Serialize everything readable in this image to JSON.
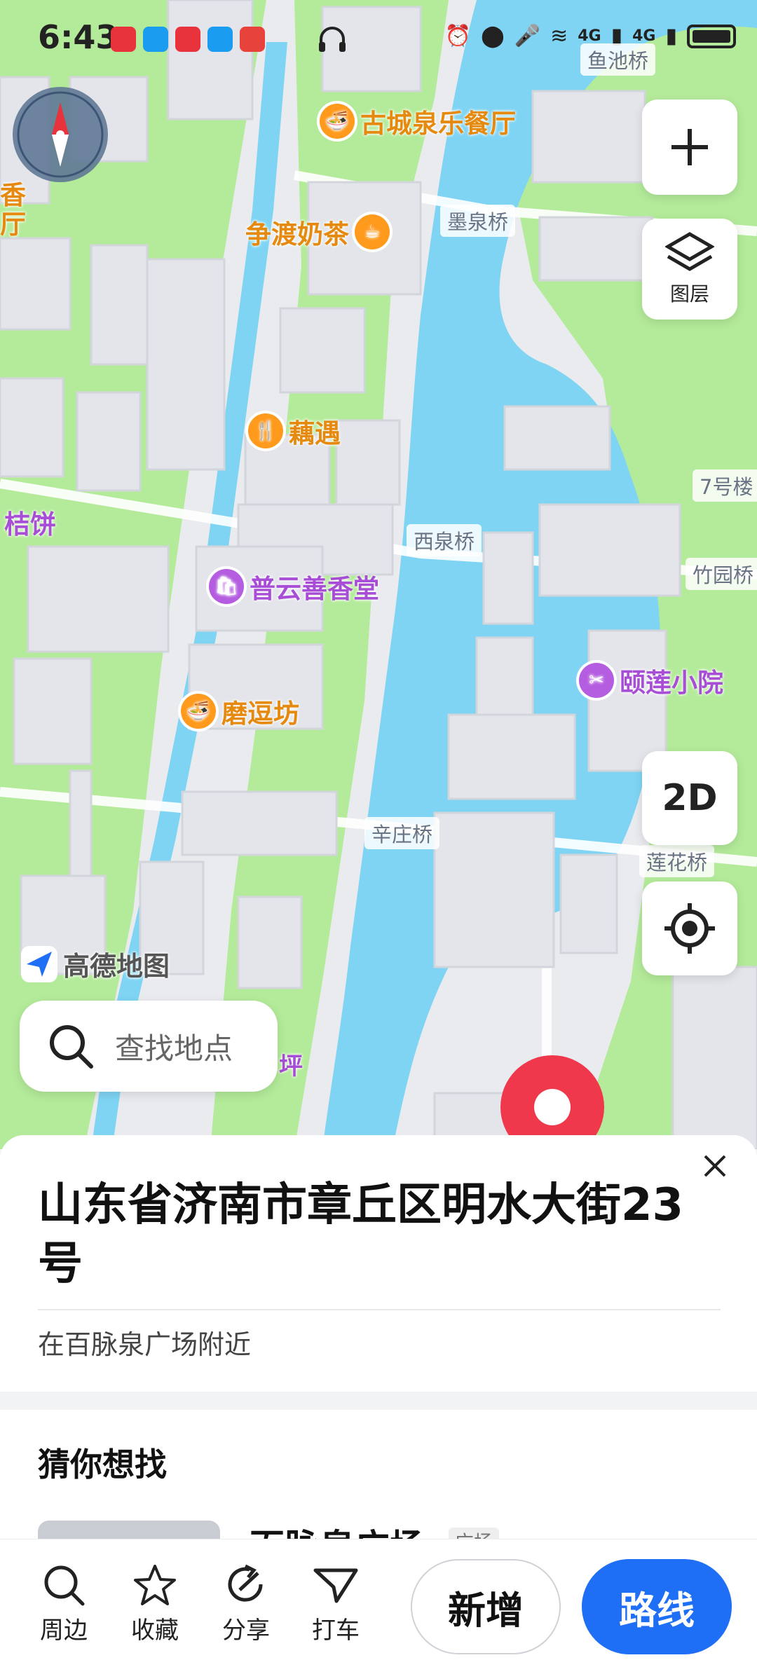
{
  "status_bar": {
    "time": "6:43",
    "network_left": "4G",
    "network_right": "4G"
  },
  "map": {
    "pois": [
      {
        "name": "古城泉乐餐厅",
        "icon": "noodle-icon",
        "color": "orange"
      },
      {
        "name": "争渡奶茶",
        "icon": "coffee-icon",
        "color": "orange"
      },
      {
        "name": "藕遇",
        "icon": "utensils-icon",
        "color": "orange"
      },
      {
        "name": "普云善香堂",
        "icon": "shopping-bag-icon",
        "color": "purple"
      },
      {
        "name": "磨逗坊",
        "icon": "noodle-icon",
        "color": "orange"
      },
      {
        "name": "颐莲小院",
        "icon": "scissors-icon",
        "color": "purple"
      },
      {
        "name": "桔饼",
        "icon": "",
        "color": "purple"
      },
      {
        "name": "香",
        "icon": "",
        "color": "orange"
      },
      {
        "name": "厅",
        "icon": "",
        "color": "orange"
      },
      {
        "name": "坪",
        "icon": "",
        "color": "purple"
      }
    ],
    "road_labels": [
      "鱼池桥",
      "墨泉桥",
      "西泉桥",
      "辛庄桥",
      "莲花桥",
      "7号楼",
      "竹园桥"
    ],
    "layers_label": "图层",
    "mode_label": "2D",
    "logo_text": "高德地图",
    "search_placeholder": "查找地点"
  },
  "sheet": {
    "title": "山东省济南市章丘区明水大街23号",
    "nearby": "在百脉泉广场附近",
    "guess_title": "猜你想找",
    "result_name": "百脉泉广场",
    "result_tag": "广场"
  },
  "bottom_bar": {
    "nearby": "周边",
    "favorite": "收藏",
    "share": "分享",
    "taxi": "打车",
    "add": "新增",
    "route": "路线"
  },
  "colors": {
    "water": "#7fd4f4",
    "park": "#b4eb9a",
    "building": "#e6e7eb",
    "accent": "#1e6ff5",
    "pin": "#f0384c"
  }
}
